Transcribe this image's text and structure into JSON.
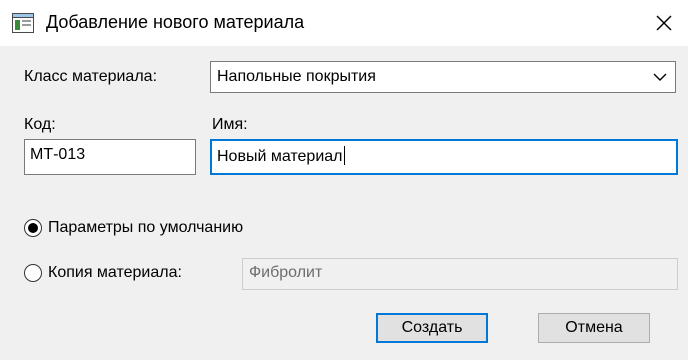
{
  "window": {
    "title": "Добавление нового материала",
    "icon": "window-app-icon",
    "close_icon": "close-icon"
  },
  "form": {
    "class_label": "Класс материала:",
    "class_value": "Напольные покрытия",
    "code_label": "Код:",
    "code_value": "МТ-013",
    "name_label": "Имя:",
    "name_value": "Новый материал"
  },
  "options": {
    "default_label": "Параметры по умолчанию",
    "default_selected": true,
    "copy_label": "Копия материала:",
    "copy_selected": false,
    "copy_value": "Фибролит"
  },
  "buttons": {
    "create_label": "Создать",
    "cancel_label": "Отмена"
  },
  "colors": {
    "focus": "#0078d7",
    "background": "#f0f0f0"
  }
}
